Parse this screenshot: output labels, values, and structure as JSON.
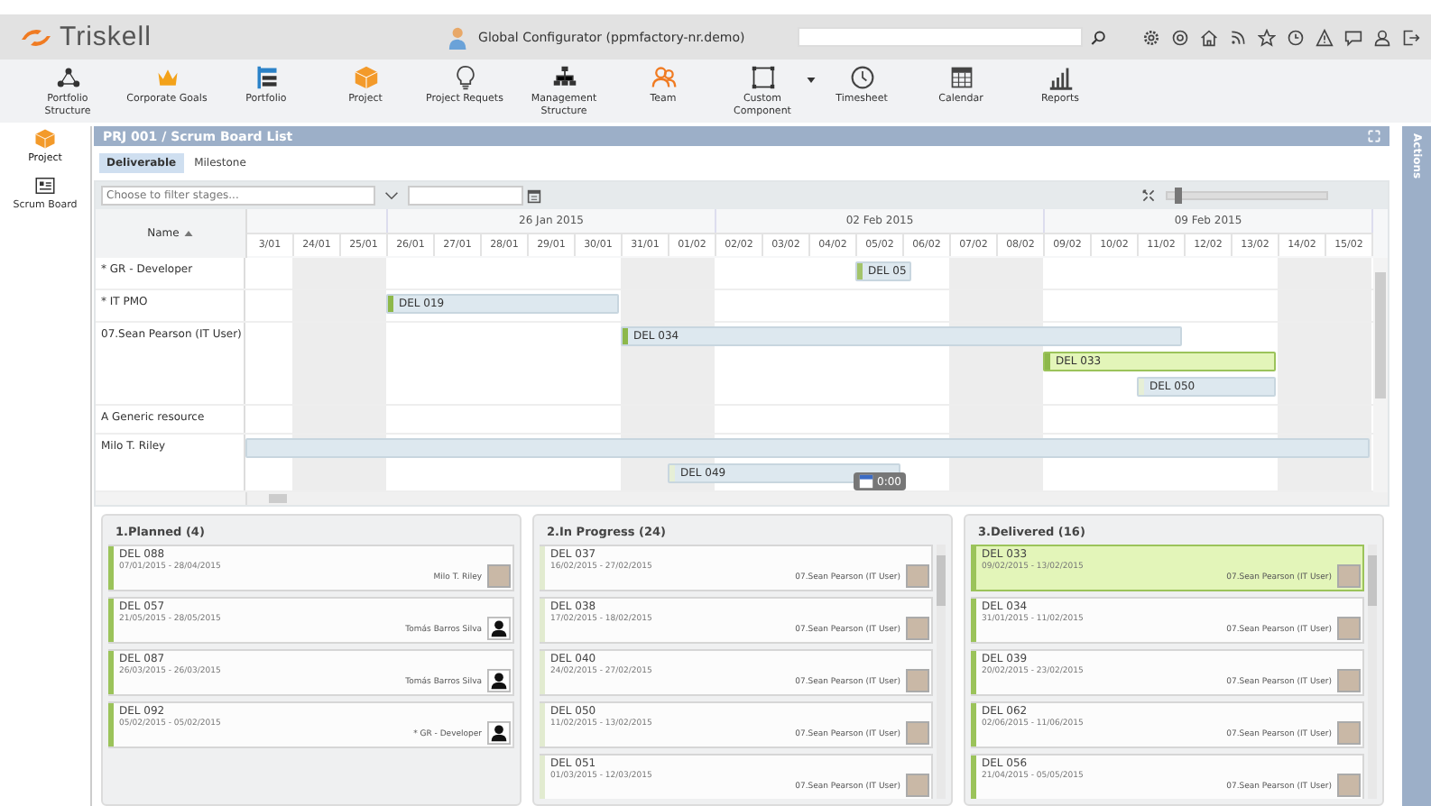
{
  "header": {
    "brand": "Triskell",
    "user": "Global Configurator (ppmfactory-nr.demo)"
  },
  "nav": [
    {
      "label": "Portfolio Structure",
      "dropdown": false
    },
    {
      "label": "Corporate Goals",
      "dropdown": false
    },
    {
      "label": "Portfolio",
      "dropdown": false
    },
    {
      "label": "Project",
      "dropdown": false
    },
    {
      "label": "Project Requets",
      "dropdown": false
    },
    {
      "label": "Management Structure",
      "dropdown": false
    },
    {
      "label": "Team",
      "dropdown": false
    },
    {
      "label": "Custom Component",
      "dropdown": true
    },
    {
      "label": "Timesheet",
      "dropdown": false
    },
    {
      "label": "Calendar",
      "dropdown": false
    },
    {
      "label": "Reports",
      "dropdown": false
    }
  ],
  "sidebar": {
    "items": [
      {
        "label": "Project",
        "selected": true
      },
      {
        "label": "Scrum Board",
        "selected": false
      }
    ]
  },
  "panel": {
    "title": "PRJ 001 / Scrum Board List"
  },
  "tabs": [
    {
      "label": "Deliverable",
      "selected": true
    },
    {
      "label": "Milestone",
      "selected": false
    }
  ],
  "gantt": {
    "filter": {
      "placeholder": "Choose to filter stages..."
    },
    "zoom": {
      "level": 0.05
    },
    "name_header": "Name",
    "weeks": [
      {
        "days": [
          {
            "label": "3/01",
            "weekend": false
          },
          {
            "label": "24/01",
            "weekend": true
          },
          {
            "label": "25/01",
            "weekend": true
          }
        ]
      },
      {
        "label": "26 Jan 2015",
        "days": [
          {
            "label": "26/01",
            "weekend": false
          },
          {
            "label": "27/01",
            "weekend": false
          },
          {
            "label": "28/01",
            "weekend": false
          },
          {
            "label": "29/01",
            "weekend": false
          },
          {
            "label": "30/01",
            "weekend": false
          },
          {
            "label": "31/01",
            "weekend": true
          },
          {
            "label": "01/02",
            "weekend": true
          }
        ]
      },
      {
        "label": "02 Feb 2015",
        "days": [
          {
            "label": "02/02",
            "weekend": false
          },
          {
            "label": "03/02",
            "weekend": false
          },
          {
            "label": "04/02",
            "weekend": false
          },
          {
            "label": "05/02",
            "weekend": false
          },
          {
            "label": "06/02",
            "weekend": false
          },
          {
            "label": "07/02",
            "weekend": true
          },
          {
            "label": "08/02",
            "weekend": true
          }
        ]
      },
      {
        "label": "09 Feb 2015",
        "days": [
          {
            "label": "09/02",
            "weekend": false
          },
          {
            "label": "10/02",
            "weekend": false
          },
          {
            "label": "11/02",
            "weekend": false
          },
          {
            "label": "12/02",
            "weekend": false
          },
          {
            "label": "13/02",
            "weekend": false
          },
          {
            "label": "14/02",
            "weekend": true
          },
          {
            "label": "15/02",
            "weekend": true
          }
        ]
      }
    ],
    "rows": [
      {
        "name": "* GR - Developer",
        "bars": [
          {
            "label": "DEL 05",
            "selected": false,
            "color": "#a3c46a"
          }
        ]
      },
      {
        "name": "* IT PMO",
        "bars": [
          {
            "label": "DEL 019",
            "selected": false,
            "color": "#8db84a"
          }
        ]
      },
      {
        "name": "07.Sean Pearson (IT User)",
        "bars": [
          {
            "label": "DEL 034",
            "selected": false,
            "color": "#8db84a"
          },
          {
            "label": "DEL 033",
            "selected": true,
            "color": "#8db84a"
          },
          {
            "label": "DEL 050",
            "selected": false,
            "color": "#e6efd6"
          }
        ]
      },
      {
        "name": "A Generic resource",
        "bars": []
      },
      {
        "name": "Milo T. Riley",
        "bars": [
          {
            "selected": false
          },
          {
            "label": "DEL 049",
            "selected": false,
            "color": "#e6efd6"
          }
        ]
      }
    ],
    "tooltip": {
      "text": "0:00"
    }
  },
  "kanban": [
    {
      "title": "1.Planned (4)",
      "color": "#9bc35a",
      "cards": [
        {
          "title": "DEL 088",
          "dates": "07/01/2015 - 28/04/2015",
          "assignee": "Milo T. Riley",
          "kind": "photo",
          "selected": false
        },
        {
          "title": "DEL 057",
          "dates": "21/05/2015 - 28/05/2015",
          "assignee": "Tomás Barros Silva",
          "kind": "silhouette",
          "selected": false
        },
        {
          "title": "DEL 087",
          "dates": "26/03/2015 - 26/03/2015",
          "assignee": "Tomás Barros Silva",
          "kind": "silhouette",
          "selected": false
        },
        {
          "title": "DEL 092",
          "dates": "05/02/2015 - 05/02/2015",
          "assignee": "* GR - Developer",
          "kind": "silhouette",
          "selected": false
        }
      ]
    },
    {
      "title": "2.In Progress (24)",
      "color": "#e2ebd0",
      "cards": [
        {
          "title": "DEL 037",
          "dates": "16/02/2015 - 27/02/2015",
          "assignee": "07.Sean Pearson (IT User)",
          "kind": "photo",
          "selected": false
        },
        {
          "title": "DEL 038",
          "dates": "17/02/2015 - 18/02/2015",
          "assignee": "07.Sean Pearson (IT User)",
          "kind": "photo",
          "selected": false
        },
        {
          "title": "DEL 040",
          "dates": "24/02/2015 - 27/02/2015",
          "assignee": "07.Sean Pearson (IT User)",
          "kind": "photo",
          "selected": false
        },
        {
          "title": "DEL 050",
          "dates": "11/02/2015 - 13/02/2015",
          "assignee": "07.Sean Pearson (IT User)",
          "kind": "photo",
          "selected": false
        },
        {
          "title": "DEL 051",
          "dates": "01/03/2015 - 12/03/2015",
          "assignee": "07.Sean Pearson (IT User)",
          "kind": "photo",
          "selected": false
        }
      ]
    },
    {
      "title": "3.Delivered (16)",
      "color": "#9bc35a",
      "cards": [
        {
          "title": "DEL 033",
          "dates": "09/02/2015 - 13/02/2015",
          "assignee": "07.Sean Pearson (IT User)",
          "kind": "photo",
          "selected": true
        },
        {
          "title": "DEL 034",
          "dates": "31/01/2015 - 11/02/2015",
          "assignee": "07.Sean Pearson (IT User)",
          "kind": "photo",
          "selected": false
        },
        {
          "title": "DEL 039",
          "dates": "20/02/2015 - 23/02/2015",
          "assignee": "07.Sean Pearson (IT User)",
          "kind": "photo",
          "selected": false
        },
        {
          "title": "DEL 062",
          "dates": "02/06/2015 - 11/06/2015",
          "assignee": "07.Sean Pearson (IT User)",
          "kind": "photo",
          "selected": false
        },
        {
          "title": "DEL 056",
          "dates": "21/04/2015 - 05/05/2015",
          "assignee": "07.Sean Pearson (IT User)",
          "kind": "photo",
          "selected": false
        }
      ]
    }
  ],
  "actions": {
    "label": "Actions"
  }
}
